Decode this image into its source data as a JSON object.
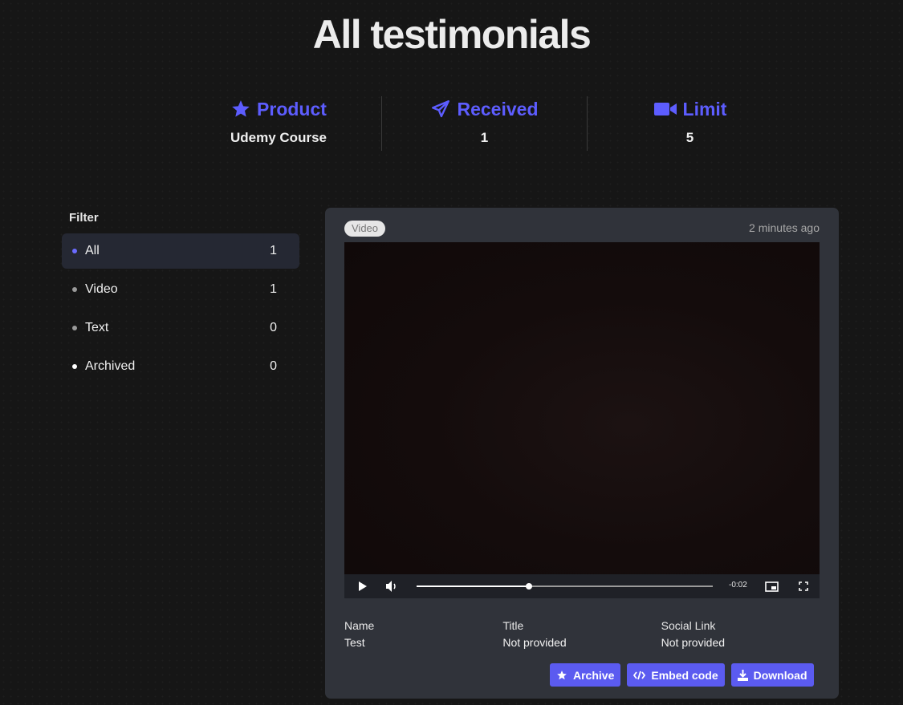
{
  "page": {
    "title": "All testimonials"
  },
  "stats": [
    {
      "label": "Product",
      "value": "Udemy Course",
      "icon": "star-icon"
    },
    {
      "label": "Received",
      "value": "1",
      "icon": "paper-plane-icon"
    },
    {
      "label": "Limit",
      "value": "5",
      "icon": "video-camera-icon"
    }
  ],
  "filter": {
    "title": "Filter",
    "items": [
      {
        "label": "All",
        "count": "1",
        "dot_color": "#6b6bff"
      },
      {
        "label": "Video",
        "count": "1",
        "dot_color": "#9a9a9a"
      },
      {
        "label": "Text",
        "count": "0",
        "dot_color": "#9a9a9a"
      },
      {
        "label": "Archived",
        "count": "0",
        "dot_color": "#ffffff"
      }
    ]
  },
  "testimonial": {
    "type_badge": "Video",
    "time": "2 minutes ago",
    "player": {
      "remaining": "-0:02",
      "progress": 0.38
    },
    "fields": [
      {
        "label": "Name",
        "value": "Test"
      },
      {
        "label": "Title",
        "value": "Not provided"
      },
      {
        "label": "Social Link",
        "value": "Not provided"
      }
    ],
    "actions": {
      "archive": "Archive",
      "embed": "Embed code",
      "download": "Download"
    }
  },
  "colors": {
    "accent": "#5b5bf0",
    "card": "#30333a",
    "background": "#161616"
  }
}
